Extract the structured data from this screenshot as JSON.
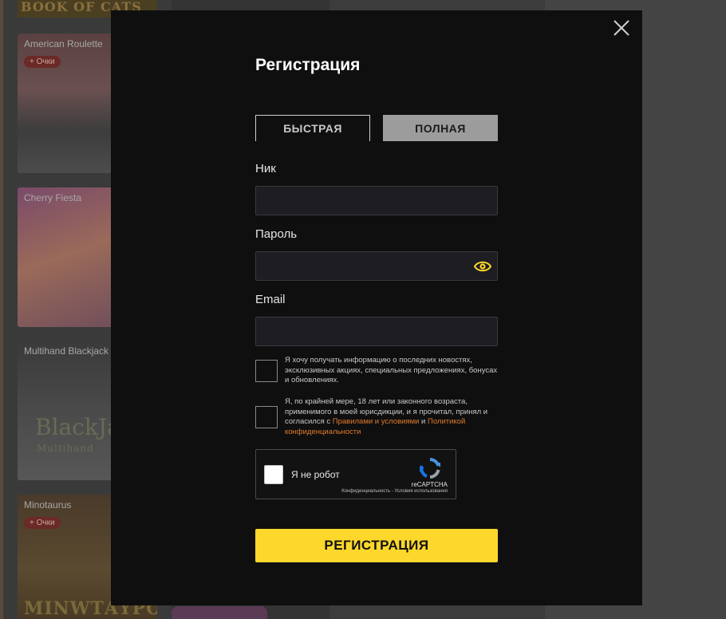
{
  "background": {
    "banner_text": "BOOK OF CATS",
    "games": [
      {
        "title": "American Roulette",
        "badge": "+ Очки"
      },
      {
        "title": "Cherry Fiesta",
        "badge": ""
      },
      {
        "title": "Multihand Blackjack",
        "badge": "",
        "art_title": "BlackJa",
        "art_subtitle": "Multihand"
      },
      {
        "title": "Minotaurus",
        "badge": "+ Очки",
        "art_title": "ΜΙΝWΤΑΥΡΟΣ"
      }
    ]
  },
  "modal": {
    "title": "Регистрация",
    "close_icon": "close-icon",
    "tabs": [
      {
        "label": "БЫСТРАЯ",
        "active": true
      },
      {
        "label": "ПОЛНАЯ",
        "active": false
      }
    ],
    "fields": {
      "nick": {
        "label": "Ник",
        "value": "",
        "placeholder": ""
      },
      "password": {
        "label": "Пароль",
        "value": "",
        "placeholder": "",
        "toggle_icon": "eye-icon"
      },
      "email": {
        "label": "Email",
        "value": "",
        "placeholder": ""
      }
    },
    "consents": {
      "newsletter": {
        "text": "Я хочу получать информацию о последних новостях, эксклюзивных акциях, специальных предложениях, бонусах и обновлениях."
      },
      "age": {
        "text_before": "Я, по крайней мере, 18 лет или законного возраста, применимого в моей юрисдикции, и я прочитал, принял и согласился с ",
        "terms_link": "Правилами и условиями",
        "text_between": " и ",
        "privacy_link": "Политикой конфиденциальности"
      }
    },
    "recaptcha": {
      "label": "Я не робот",
      "brand": "reCAPTCHA",
      "terms": "Конфиденциальность - Условия использования"
    },
    "submit_label": "РЕГИСТРАЦИЯ"
  },
  "colors": {
    "accent": "#fdd72b",
    "link": "#e07b2a",
    "modal_bg": "#0f0f10"
  }
}
